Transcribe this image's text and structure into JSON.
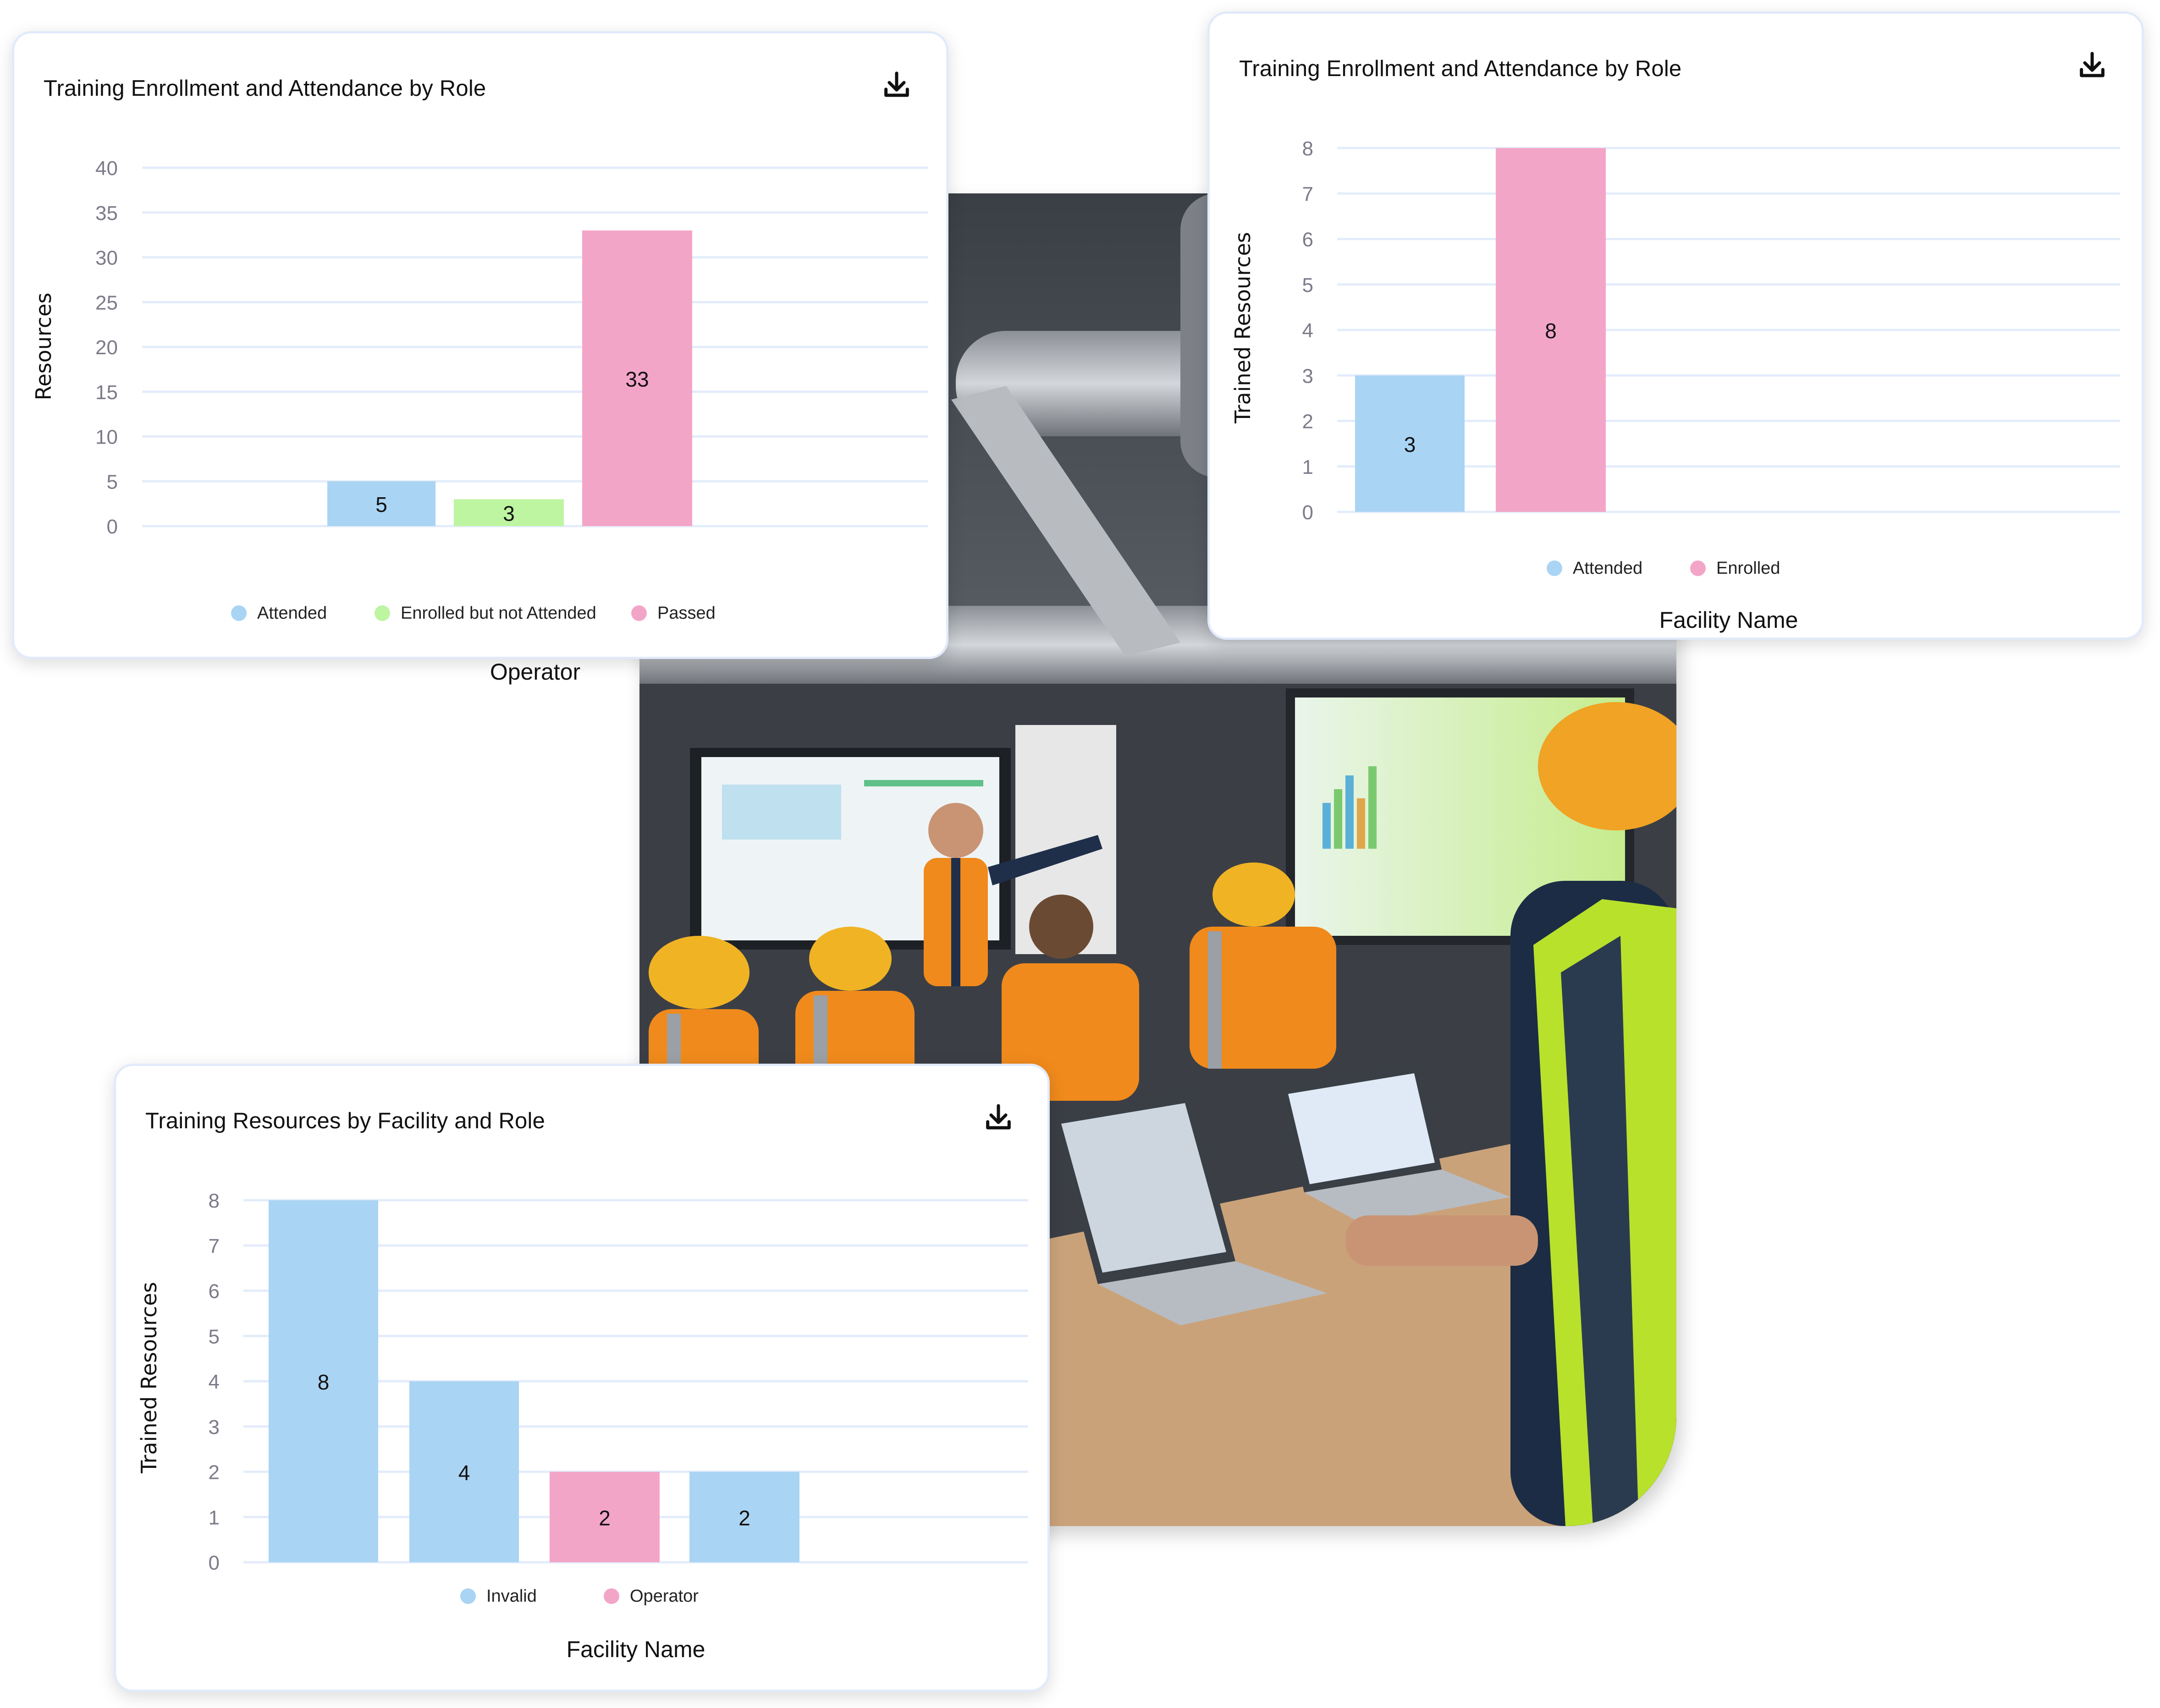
{
  "photo": {
    "description": "Training session: workers in hard hats and safety vests watching a presenter and screens with laptops",
    "icon": "training-photo"
  },
  "cards": [
    {
      "id": "card-enrollment-operator",
      "title": "Training Enrollment and Attendance by Role",
      "download_icon": "download-icon",
      "download_label": "Download"
    },
    {
      "id": "card-enrollment-facility",
      "title": "Training Enrollment and Attendance by Role",
      "download_icon": "download-icon",
      "download_label": "Download"
    },
    {
      "id": "card-resources-facility",
      "title": "Training Resources by Facility and Role",
      "download_icon": "download-icon",
      "download_label": "Download"
    }
  ],
  "colors": {
    "blue": "#aad4f3",
    "green": "#bdf5a0",
    "pink": "#f3a5c8",
    "grid": "#e3ecfb",
    "tick": "#7b7b8a",
    "border": "#e2eafb"
  },
  "chart_data": [
    {
      "type": "bar",
      "title": "Training Enrollment and Attendance by Role",
      "xlabel": "Operator",
      "ylabel": "Resources",
      "ylim": [
        0,
        40
      ],
      "yticks": [
        0,
        5,
        10,
        15,
        20,
        25,
        30,
        35,
        40
      ],
      "grid": true,
      "legend_position": "bottom",
      "categories": [
        "Operator"
      ],
      "series": [
        {
          "name": "Attended",
          "values": [
            5
          ],
          "color": "#aad4f3"
        },
        {
          "name": "Enrolled but not Attended",
          "values": [
            3
          ],
          "color": "#bdf5a0"
        },
        {
          "name": "Passed",
          "values": [
            33
          ],
          "color": "#f3a5c8"
        }
      ]
    },
    {
      "type": "bar",
      "title": "Training Enrollment and Attendance by Role",
      "xlabel": "Facility Name",
      "ylabel": "Trained Resources",
      "ylim": [
        0,
        8
      ],
      "yticks": [
        0,
        1,
        2,
        3,
        4,
        5,
        6,
        7,
        8
      ],
      "grid": true,
      "legend_position": "bottom",
      "categories": [
        ""
      ],
      "series": [
        {
          "name": "Attended",
          "values": [
            3
          ],
          "color": "#aad4f3"
        },
        {
          "name": "Enrolled",
          "values": [
            8
          ],
          "color": "#f3a5c8"
        }
      ]
    },
    {
      "type": "bar",
      "title": "Training Resources by Facility and Role",
      "xlabel": "Facility Name",
      "ylabel": "Trained Resources",
      "ylim": [
        0,
        8
      ],
      "yticks": [
        0,
        1,
        2,
        3,
        4,
        5,
        6,
        7,
        8
      ],
      "grid": true,
      "legend_position": "bottom",
      "bars": [
        {
          "series": "Invalid",
          "value": 8
        },
        {
          "series": "Invalid",
          "value": 4
        },
        {
          "series": "Operator",
          "value": 2
        },
        {
          "series": "Invalid",
          "value": 2
        }
      ],
      "series": [
        {
          "name": "Invalid",
          "color": "#aad4f3"
        },
        {
          "name": "Operator",
          "color": "#f3a5c8"
        }
      ]
    }
  ]
}
